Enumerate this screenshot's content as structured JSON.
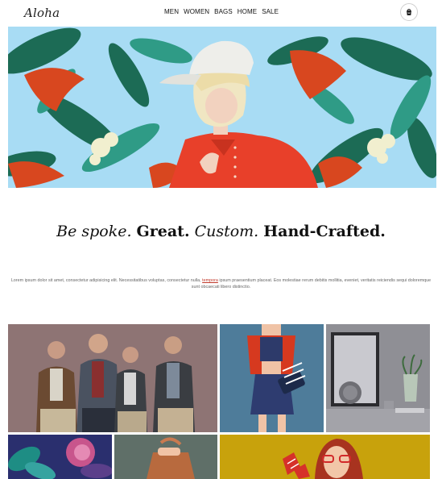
{
  "header": {
    "logo": "Aloha",
    "nav": [
      "MEN",
      "WOMEN",
      "BAGS",
      "HOME",
      "SALE"
    ],
    "cart_icon": "shopping-bag-icon"
  },
  "hero": {
    "image": "hero-image",
    "background": "tropical leaves and flowers on light blue",
    "colors": {
      "sky": "#a8dcf4",
      "leaf": "#1c6b55",
      "flower": "#d8471f",
      "shirt": "#e8402a",
      "cap": "#eeeeea"
    }
  },
  "tagline": {
    "part1": "Be spoke.",
    "part2": "Great.",
    "part3": "Custom.",
    "part4": "Hand-Crafted."
  },
  "description": {
    "before": "Lorem ipsum dolor sit amet, consectetur adipisicing elit. Necessitatibus voluptas, consectetur nulla,",
    "link": "tempora",
    "after": "ipsum praesentium placeat. Eos molestiae rerum debitis mollitia, eveniet, veritatis reiciendis sequi doloremque sunt obcaecati libero distinctio."
  },
  "gallery": {
    "tiles": [
      "men-group",
      "woman-red-vest",
      "desk-imac",
      "flowers",
      "leather-bag",
      "woman-yellow"
    ]
  }
}
